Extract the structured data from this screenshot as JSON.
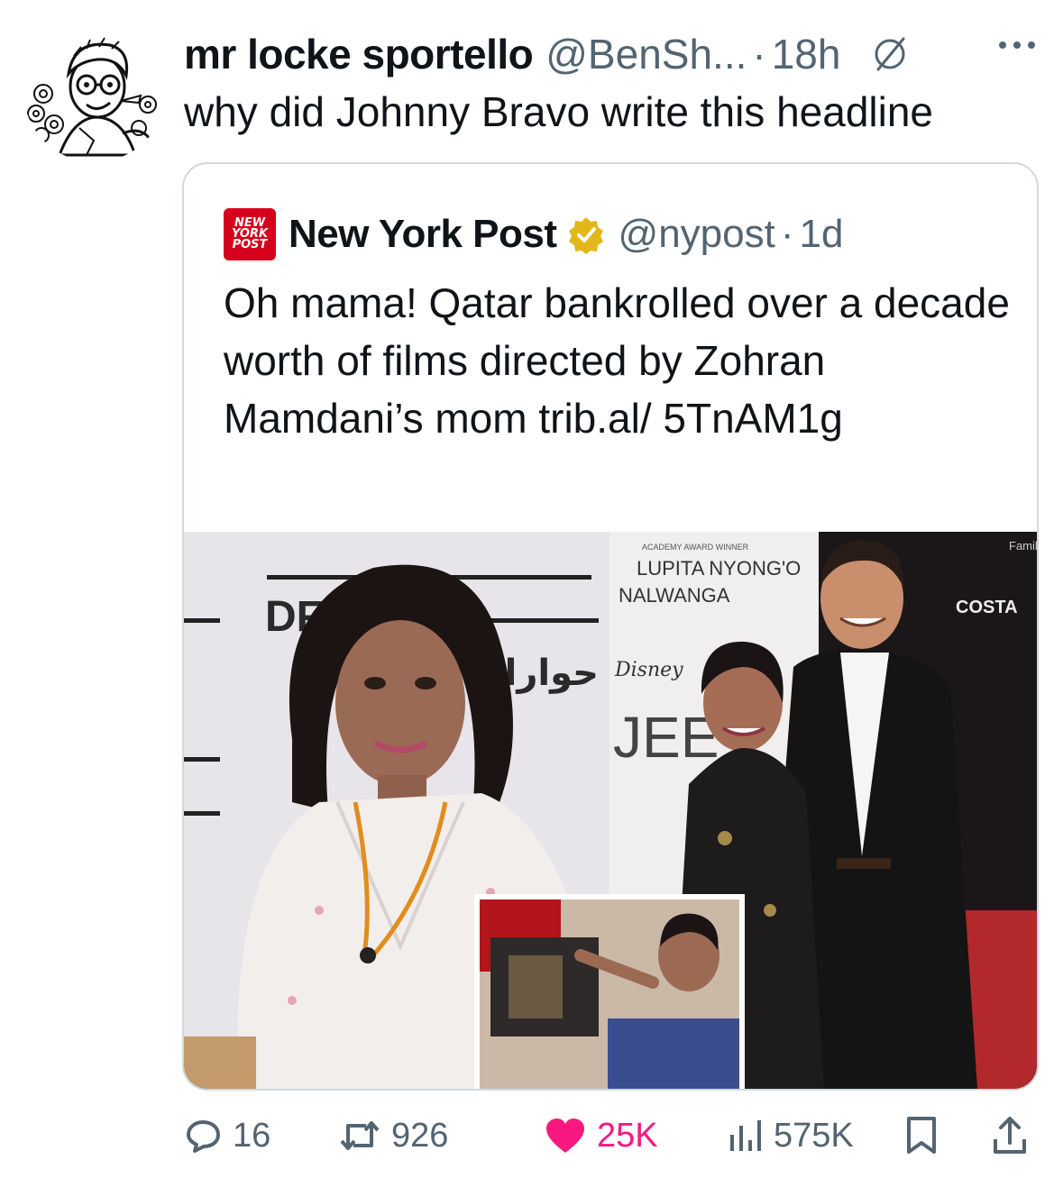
{
  "tweet": {
    "author_name": "mr locke sportello",
    "handle": "@BenSh...",
    "separator": "·",
    "time": "18h",
    "text": "why did Johnny Bravo write this headline"
  },
  "quoted": {
    "logo_text": "NEW YORK POST",
    "name": "New York Post",
    "handle": "@nypost",
    "separator": "·",
    "time": "1d",
    "text": "Oh mama! Qatar bankrolled over a decade worth of films directed by Zohran Mamdani’s mom trib.al/ 5TnAM1g",
    "media": {
      "backdrop_text_left": "DFI",
      "arabic_text": "حوارات الدوحة",
      "premiere_caption_small": "ACADEMY AWARD WINNER",
      "premiere_name": "LUPITA NYONG'O",
      "premiere_name_2": "NALWANGA",
      "disney_logo": "Disney",
      "poster_letters": "JEE",
      "costa_logo": "COSTA",
      "family_text": "Family"
    }
  },
  "actions": {
    "replies": "16",
    "reposts": "926",
    "likes": "25K",
    "views": "575K"
  },
  "colors": {
    "text_primary": "#0f1419",
    "text_secondary": "#536471",
    "like_pink": "#f91880",
    "verified_gold": "#e2b719",
    "nyp_red": "#d6001c",
    "border": "#cfd9de"
  },
  "icons": [
    "avatar-cartoon",
    "grok-icon",
    "more-icon",
    "verified-badge-icon",
    "reply-icon",
    "repost-icon",
    "like-heart-icon",
    "views-icon",
    "bookmark-icon",
    "share-icon"
  ]
}
